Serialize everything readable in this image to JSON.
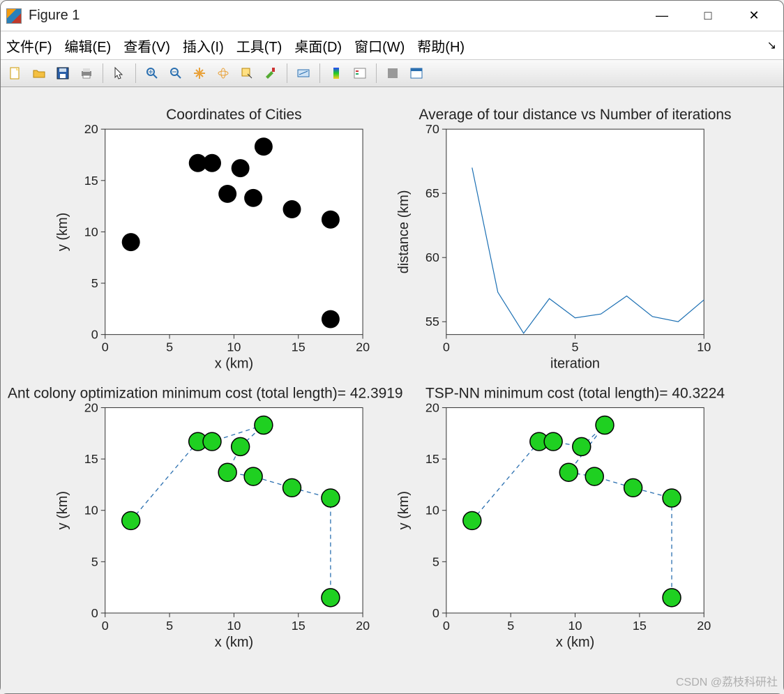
{
  "window": {
    "title": "Figure 1",
    "min_label": "—",
    "max_label": "□",
    "close_label": "✕"
  },
  "menu": {
    "file": "文件(F)",
    "edit": "编辑(E)",
    "view": "查看(V)",
    "insert": "插入(I)",
    "tools": "工具(T)",
    "desktop": "桌面(D)",
    "window": "窗口(W)",
    "help": "帮助(H)"
  },
  "toolbar_icons": [
    "new-file-icon",
    "open-icon",
    "save-icon",
    "print-icon",
    "|",
    "pointer-icon",
    "|",
    "zoom-in-icon",
    "zoom-out-icon",
    "pan-icon",
    "rotate3d-icon",
    "data-cursor-icon",
    "brush-icon",
    "|",
    "link-plots-icon",
    "|",
    "colorbar-icon",
    "legend-icon",
    "|",
    "hide-plot-icon",
    "show-plot-icon"
  ],
  "watermark": "CSDN @荔枝科研社",
  "chart_data": [
    {
      "type": "scatter",
      "title": "Coordinates of Cities",
      "xlabel": "x  (km)",
      "ylabel": "y (km)",
      "xlim": [
        0,
        20
      ],
      "ylim": [
        0,
        20
      ],
      "xticks": [
        0,
        5,
        10,
        15,
        20
      ],
      "yticks": [
        0,
        5,
        10,
        15,
        20
      ],
      "series": [
        {
          "name": "cities",
          "marker": "filled-circle",
          "color": "#000",
          "size": 13,
          "points": [
            {
              "x": 2,
              "y": 9
            },
            {
              "x": 7.2,
              "y": 16.7
            },
            {
              "x": 8.3,
              "y": 16.7
            },
            {
              "x": 9.5,
              "y": 13.7
            },
            {
              "x": 10.5,
              "y": 16.2
            },
            {
              "x": 11.5,
              "y": 13.3
            },
            {
              "x": 12.3,
              "y": 18.3
            },
            {
              "x": 14.5,
              "y": 12.2
            },
            {
              "x": 17.5,
              "y": 11.2
            },
            {
              "x": 17.5,
              "y": 1.5
            }
          ]
        }
      ]
    },
    {
      "type": "line",
      "title": "Average of tour distance vs Number of iterations",
      "xlabel": "iteration",
      "ylabel": "distance (km)",
      "xlim": [
        0,
        10
      ],
      "ylim": [
        54,
        70
      ],
      "xticks": [
        0,
        5,
        10
      ],
      "yticks": [
        55,
        60,
        65,
        70
      ],
      "series": [
        {
          "name": "avg-distance",
          "color": "#1b6fb3",
          "stroke": 1.2,
          "x": [
            1,
            2,
            3,
            4,
            5,
            6,
            7,
            8,
            9,
            10
          ],
          "values": [
            67.0,
            57.3,
            54.1,
            56.8,
            55.3,
            55.6,
            57.0,
            55.4,
            55.0,
            56.7
          ]
        }
      ]
    },
    {
      "type": "line-scatter",
      "title": "Ant colony optimization  minimum cost (total length)= 42.3919",
      "xlabel": "x  (km)",
      "ylabel": "y (km)",
      "xlim": [
        0,
        20
      ],
      "ylim": [
        0,
        20
      ],
      "xticks": [
        0,
        5,
        10,
        15,
        20
      ],
      "yticks": [
        0,
        5,
        10,
        15,
        20
      ],
      "marker": {
        "fill": "#1fd021",
        "stroke": "#000",
        "size": 13
      },
      "line": {
        "color": "#2a6fb0",
        "dash": "6 5",
        "width": 1.3
      },
      "path_order": [
        0,
        1,
        2,
        6,
        4,
        3,
        5,
        7,
        8,
        9
      ],
      "points": [
        {
          "x": 2,
          "y": 9
        },
        {
          "x": 7.2,
          "y": 16.7
        },
        {
          "x": 8.3,
          "y": 16.7
        },
        {
          "x": 9.5,
          "y": 13.7
        },
        {
          "x": 10.5,
          "y": 16.2
        },
        {
          "x": 11.5,
          "y": 13.3
        },
        {
          "x": 12.3,
          "y": 18.3
        },
        {
          "x": 14.5,
          "y": 12.2
        },
        {
          "x": 17.5,
          "y": 11.2
        },
        {
          "x": 17.5,
          "y": 1.5
        }
      ]
    },
    {
      "type": "line-scatter",
      "title": "TSP-NN  minimum cost (total length)= 40.3224",
      "xlabel": "x  (km)",
      "ylabel": "y (km)",
      "xlim": [
        0,
        20
      ],
      "ylim": [
        0,
        20
      ],
      "xticks": [
        0,
        5,
        10,
        15,
        20
      ],
      "yticks": [
        0,
        5,
        10,
        15,
        20
      ],
      "marker": {
        "fill": "#1fd021",
        "stroke": "#000",
        "size": 13
      },
      "line": {
        "color": "#2a6fb0",
        "dash": "6 5",
        "width": 1.3
      },
      "path_order": [
        0,
        1,
        2,
        4,
        6,
        3,
        5,
        7,
        8,
        9
      ],
      "points": [
        {
          "x": 2,
          "y": 9
        },
        {
          "x": 7.2,
          "y": 16.7
        },
        {
          "x": 8.3,
          "y": 16.7
        },
        {
          "x": 9.5,
          "y": 13.7
        },
        {
          "x": 10.5,
          "y": 16.2
        },
        {
          "x": 11.5,
          "y": 13.3
        },
        {
          "x": 12.3,
          "y": 18.3
        },
        {
          "x": 14.5,
          "y": 12.2
        },
        {
          "x": 17.5,
          "y": 11.2
        },
        {
          "x": 17.5,
          "y": 1.5
        }
      ]
    }
  ]
}
